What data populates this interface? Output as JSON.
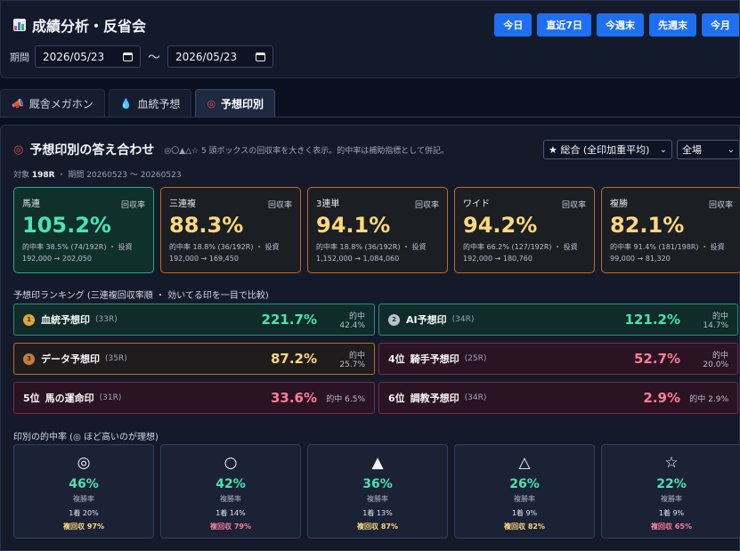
{
  "header": {
    "title": "成績分析・反省会",
    "quick_buttons": [
      "今日",
      "直近7日",
      "今週末",
      "先週末",
      "今月"
    ],
    "period_label": "期間",
    "date_from": "2026/05/23",
    "tilde": "〜",
    "date_to": "2026/05/23"
  },
  "tabs": [
    {
      "label": "厩舎メガホン",
      "icon": "megaphone-icon"
    },
    {
      "label": "血統予想",
      "icon": "blood-drop-icon"
    },
    {
      "label": "予想印別",
      "icon": "target-icon"
    }
  ],
  "panel": {
    "title": "予想印別の答え合わせ",
    "desc": "◎〇▲△☆ 5 頭ボックスの回収率を大きく表示。的中率は補助指標として併記。",
    "target_prefix": "対象",
    "target_count": "198R",
    "target_period": "・ 期間 20260523 〜 20260523",
    "select_mode": "★ 総合 (全印加重平均)",
    "select_venue": "全場"
  },
  "bet_cards": [
    {
      "name": "馬連",
      "label": "回収率",
      "value": "105.2%",
      "line1": "的中率 38.5% (74/192R) ・ 投資",
      "line2": "192,000 → 202,050",
      "best": true
    },
    {
      "name": "三連複",
      "label": "回収率",
      "value": "88.3%",
      "line1": "的中率 18.8% (36/192R) ・ 投資",
      "line2": "192,000 → 169,450",
      "best": false
    },
    {
      "name": "3連単",
      "label": "回収率",
      "value": "94.1%",
      "line1": "的中率 18.8% (36/192R) ・ 投資",
      "line2": "1,152,000 → 1,084,060",
      "best": false
    },
    {
      "name": "ワイド",
      "label": "回収率",
      "value": "94.2%",
      "line1": "的中率 66.2% (127/192R) ・ 投資",
      "line2": "192,000 → 180,760",
      "best": false
    },
    {
      "name": "複勝",
      "label": "回収率",
      "value": "82.1%",
      "line1": "的中率 91.4% (181/198R) ・ 投資",
      "line2": "99,000 → 81,320",
      "best": false
    }
  ],
  "ranking": {
    "title": "予想印ランキング (三連複回収率順 ・ 効いてる印を一目で比較)",
    "items": [
      {
        "rank": "",
        "medal": "gold",
        "name": "血統予想印",
        "count": "(33R)",
        "rate": "221.7%",
        "hit": "的中 42.4%",
        "tone": "green",
        "rate_color": "#4be3b0"
      },
      {
        "rank": "",
        "medal": "silver",
        "name": "AI予想印",
        "count": "(34R)",
        "rate": "121.2%",
        "hit": "的中 14.7%",
        "tone": "green",
        "rate_color": "#4be3b0"
      },
      {
        "rank": "",
        "medal": "bronze",
        "name": "データ予想印",
        "count": "(35R)",
        "rate": "87.2%",
        "hit": "的中 25.7%",
        "tone": "orange",
        "rate_color": "#ffd97a"
      },
      {
        "rank": "4位",
        "medal": "",
        "name": "騎手予想印",
        "count": "(25R)",
        "rate": "52.7%",
        "hit": "的中 20.0%",
        "tone": "red",
        "rate_color": "#ff7d98"
      },
      {
        "rank": "5位",
        "medal": "",
        "name": "馬の運命印",
        "count": "(31R)",
        "rate": "33.6%",
        "hit": "的中 6.5%",
        "tone": "red",
        "rate_color": "#ff7d98"
      },
      {
        "rank": "6位",
        "medal": "",
        "name": "調教予想印",
        "count": "(34R)",
        "rate": "2.9%",
        "hit": "的中 2.9%",
        "tone": "red",
        "rate_color": "#ff7d98"
      }
    ]
  },
  "marks": {
    "title": "印別の的中率 (◎ ほど高いのが理想)",
    "items": [
      {
        "symbol": "◎",
        "pct": "46%",
        "label": "複勝率",
        "win": "1着 20%",
        "ret": "複回収 97%",
        "ret_color": "#ffd97a"
      },
      {
        "symbol": "○",
        "pct": "42%",
        "label": "複勝率",
        "win": "1着 14%",
        "ret": "複回収 79%",
        "ret_color": "#ff7d98"
      },
      {
        "symbol": "▲",
        "pct": "36%",
        "label": "複勝率",
        "win": "1着 13%",
        "ret": "複回収 87%",
        "ret_color": "#ffd97a"
      },
      {
        "symbol": "△",
        "pct": "26%",
        "label": "複勝率",
        "win": "1着 9%",
        "ret": "複回収 82%",
        "ret_color": "#ffd97a"
      },
      {
        "symbol": "☆",
        "pct": "22%",
        "label": "複勝率",
        "win": "1着 9%",
        "ret": "複回収 65%",
        "ret_color": "#ff7d98"
      }
    ]
  },
  "colors": {
    "accent": "#1e6ff2",
    "good": "#4be3b0",
    "warn": "#ffd97a",
    "bad": "#ff7d98"
  }
}
